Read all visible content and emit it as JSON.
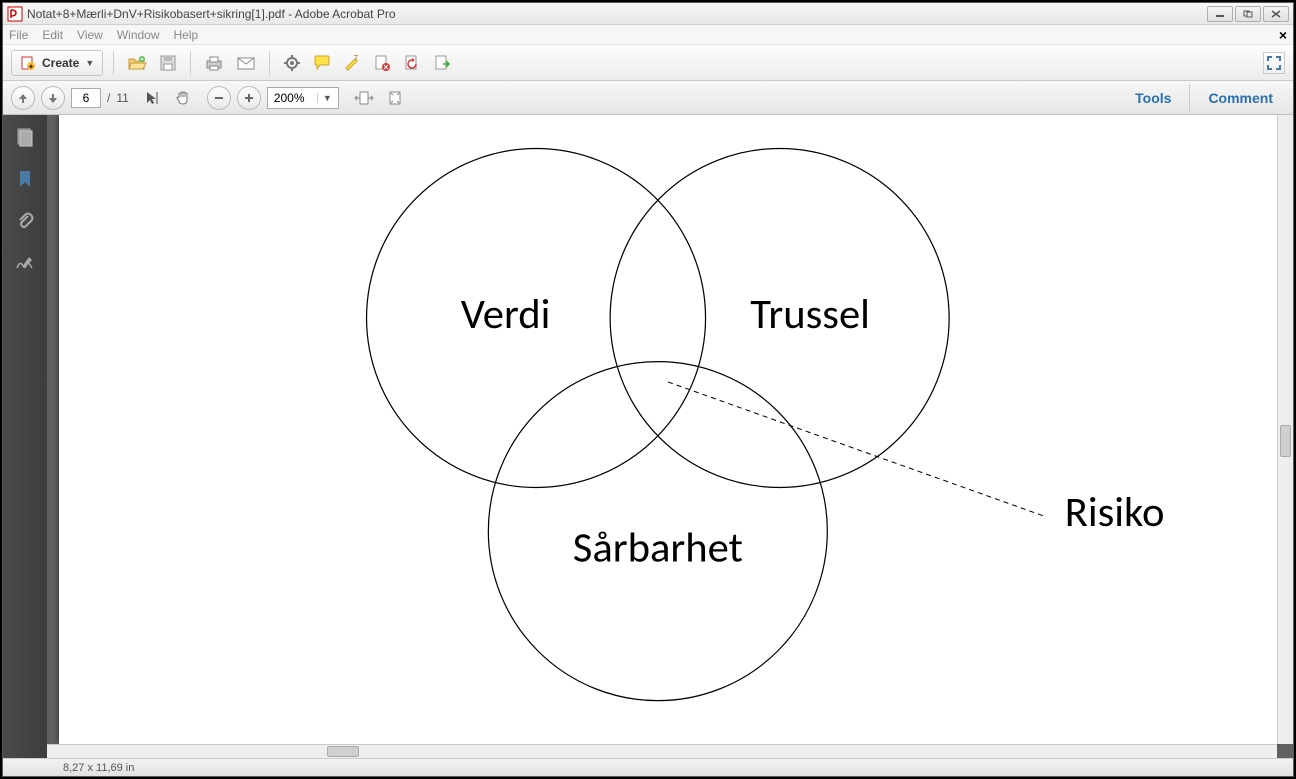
{
  "window": {
    "title": "Notat+8+Mærli+DnV+Risikobasert+sikring[1].pdf - Adobe Acrobat Pro"
  },
  "menu": {
    "file": "File",
    "edit": "Edit",
    "view": "View",
    "window": "Window",
    "help": "Help"
  },
  "toolbar": {
    "create": "Create"
  },
  "nav": {
    "current_page": "6",
    "page_sep": "/",
    "total_pages": "11",
    "zoom": "200%"
  },
  "panels": {
    "tools": "Tools",
    "comment": "Comment"
  },
  "status": {
    "dimensions": "8,27 x 11,69 in"
  },
  "chart_data": {
    "type": "venn",
    "circles": [
      {
        "label": "Verdi"
      },
      {
        "label": "Trussel"
      },
      {
        "label": "Sårbarhet"
      }
    ],
    "center_label": "Risiko"
  }
}
